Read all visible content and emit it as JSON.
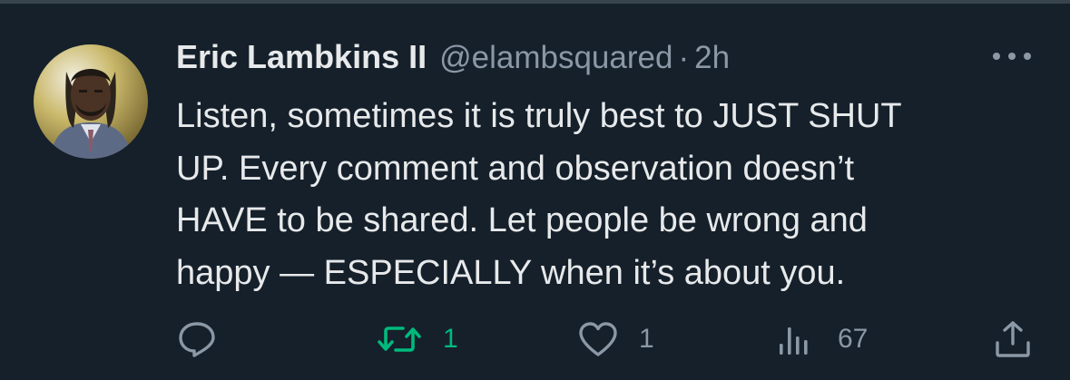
{
  "tweet": {
    "author_name": "Eric Lambkins II",
    "handle": "@elambsquared",
    "separator": "·",
    "time": "2h",
    "text_lines": [
      "Listen, sometimes it is truly best to JUST SHUT",
      "UP. Every comment and observation doesn’t",
      "HAVE to be shared. Let people be wrong and",
      "happy — ESPECIALLY when it’s about you."
    ]
  },
  "actions": {
    "reply": {
      "icon": "reply-icon"
    },
    "retweet": {
      "icon": "retweet-icon",
      "count": "1",
      "color": "#00ba7c"
    },
    "like": {
      "icon": "heart-icon",
      "count": "1"
    },
    "views": {
      "icon": "views-icon",
      "count": "67"
    },
    "share": {
      "icon": "share-icon"
    }
  },
  "colors": {
    "background": "#15202b",
    "text": "#e7e9ea",
    "muted": "#8b98a5",
    "retweet_active": "#00ba7c"
  }
}
